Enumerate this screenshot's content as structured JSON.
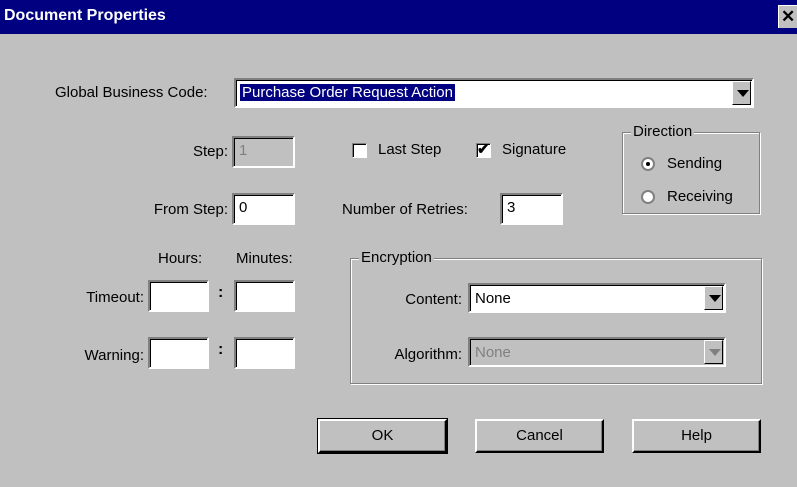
{
  "window": {
    "title": "Document Properties",
    "close_glyph": "✕"
  },
  "global_business_code": {
    "label": "Global Business Code:",
    "value": "Purchase Order Request Action"
  },
  "step": {
    "label": "Step:",
    "value": "1"
  },
  "from_step": {
    "label": "From Step:",
    "value": "0"
  },
  "last_step": {
    "label": "Last Step",
    "checked": false
  },
  "signature": {
    "label": "Signature",
    "checked": true,
    "mark": "✔"
  },
  "retries": {
    "label": "Number of Retries:",
    "value": "3"
  },
  "direction": {
    "legend": "Direction",
    "options": [
      {
        "label": "Sending",
        "selected": true
      },
      {
        "label": "Receiving",
        "selected": false
      }
    ]
  },
  "time_headers": {
    "hours": "Hours:",
    "minutes": "Minutes:"
  },
  "timeout": {
    "label": "Timeout:",
    "hours": "",
    "minutes": ""
  },
  "warning": {
    "label": "Warning:",
    "hours": "",
    "minutes": ""
  },
  "encryption": {
    "legend": "Encryption",
    "content": {
      "label": "Content:",
      "value": "None"
    },
    "algorithm": {
      "label": "Algorithm:",
      "value": "None"
    }
  },
  "buttons": {
    "ok": "OK",
    "cancel": "Cancel",
    "help": "Help"
  },
  "colors": {
    "titlebar": "#000080",
    "face": "#c0c0c0"
  }
}
